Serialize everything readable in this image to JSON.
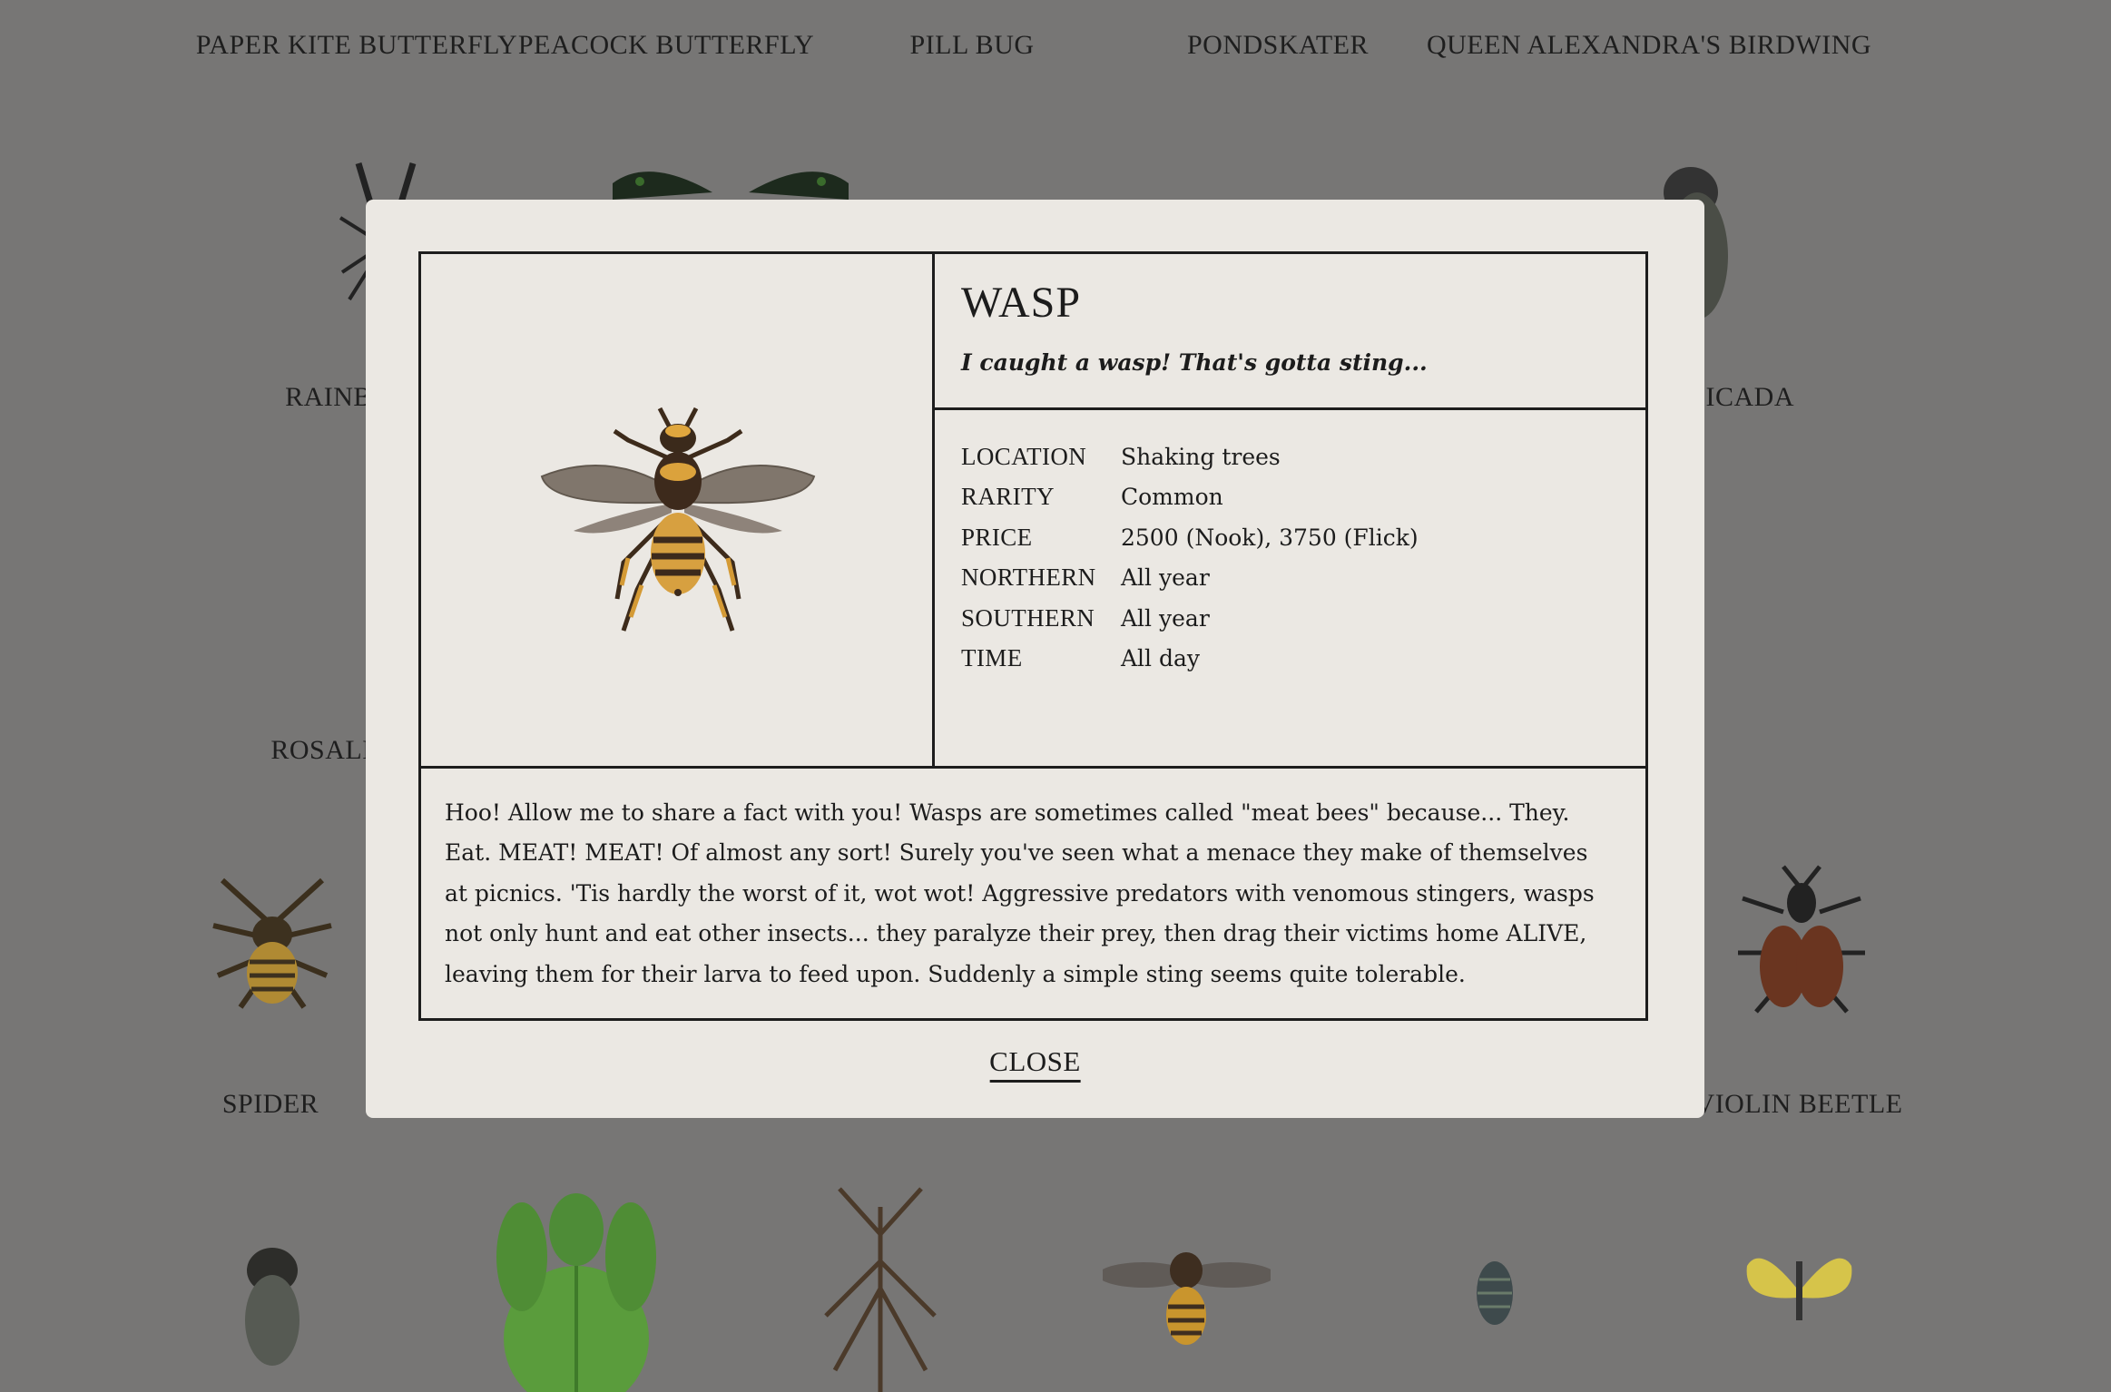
{
  "background": {
    "labels": [
      "PAPER KITE BUTTERFLY",
      "PEACOCK BUTTERFLY",
      "PILL BUG",
      "PONDSKATER",
      "QUEEN ALEXANDRA'S BIRDWING",
      "RAINB",
      "CICADA",
      "ROSALI",
      "SPIDER",
      "VIOLIN BEETLE"
    ]
  },
  "modal": {
    "title": "WASP",
    "quote": "I caught a wasp! That's gotta sting...",
    "details": [
      {
        "key": "LOCATION",
        "value": "Shaking trees"
      },
      {
        "key": "RARITY",
        "value": "Common"
      },
      {
        "key": "PRICE",
        "value": "2500 (Nook), 3750 (Flick)"
      },
      {
        "key": "NORTHERN",
        "value": "All year"
      },
      {
        "key": "SOUTHERN",
        "value": "All year"
      },
      {
        "key": "TIME",
        "value": "All day"
      }
    ],
    "description": "Hoo! Allow me to share a fact with you! Wasps are sometimes called \"meat bees\" because... They. Eat. MEAT! MEAT! Of almost any sort! Surely you've seen what a menace they make of themselves at picnics. 'Tis hardly the worst of it, wot wot! Aggressive predators with venomous stingers, wasps not only hunt and eat other insects... they paralyze their prey, then drag their victims home ALIVE, leaving them for their larva to feed upon. Suddenly a simple sting seems quite tolerable.",
    "close_label": "CLOSE"
  },
  "colors": {
    "backdrop": "#777675",
    "modal": "#ebe8e3",
    "ink": "#1d1d1d"
  }
}
